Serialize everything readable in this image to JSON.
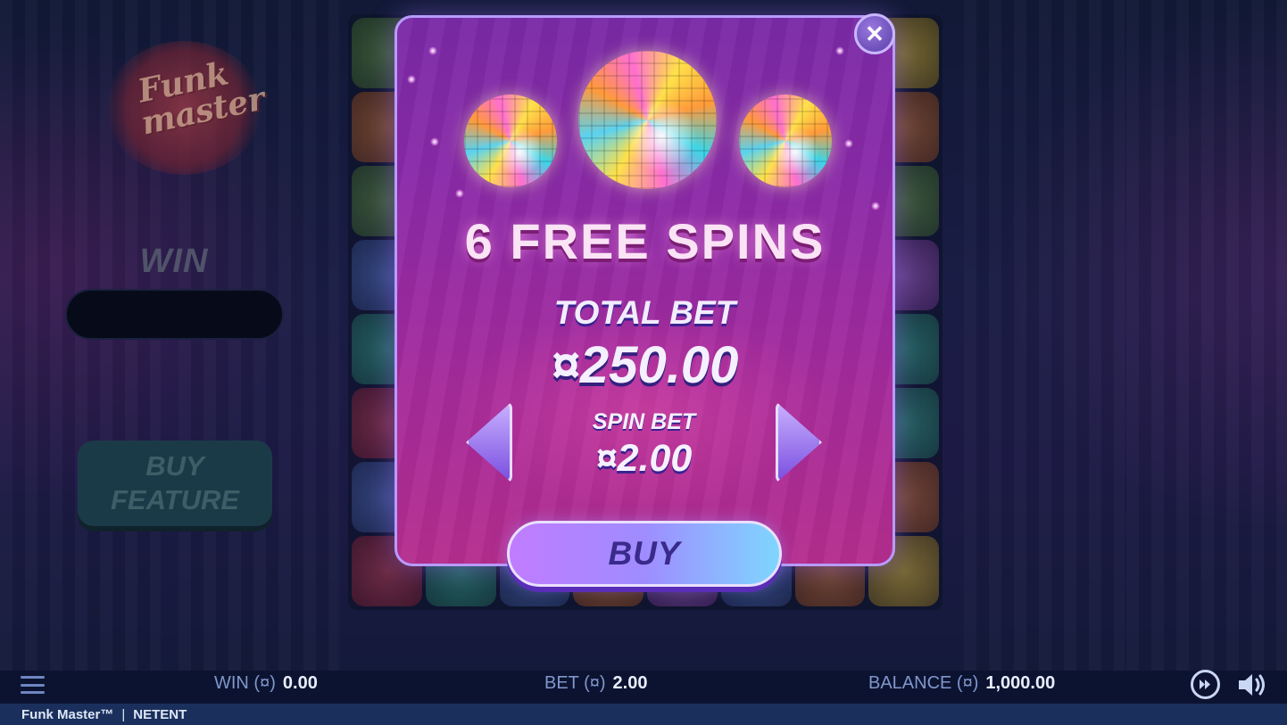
{
  "game": {
    "logo_text_line1": "Funk",
    "logo_text_line2": "master"
  },
  "left_panel": {
    "win_label": "WIN",
    "win_value": "",
    "buy_feature_line1": "BUY",
    "buy_feature_line2": "FEATURE"
  },
  "popup": {
    "close_icon": "close-icon",
    "free_spins": "6 FREE SPINS",
    "total_bet_label": "TOTAL BET",
    "total_bet_value": "¤250.00",
    "spin_bet_label": "SPIN BET",
    "spin_bet_value": "¤2.00",
    "buy_label": "BUY",
    "decrease_icon": "arrow-left-icon",
    "increase_icon": "arrow-right-icon"
  },
  "status_bar": {
    "win_label": "WIN (¤)",
    "win_value": "0.00",
    "bet_label": "BET (¤)",
    "bet_value": "2.00",
    "balance_label": "BALANCE (¤)",
    "balance_value": "1,000.00"
  },
  "footer": {
    "game_name": "Funk Master™",
    "separator": "|",
    "provider": "NETENT"
  },
  "colors": {
    "popup_top": "#7a2aa6",
    "popup_bottom": "#b52d8e",
    "bar_label": "#7f97cc",
    "footer_bg": "#1a2f5c"
  }
}
